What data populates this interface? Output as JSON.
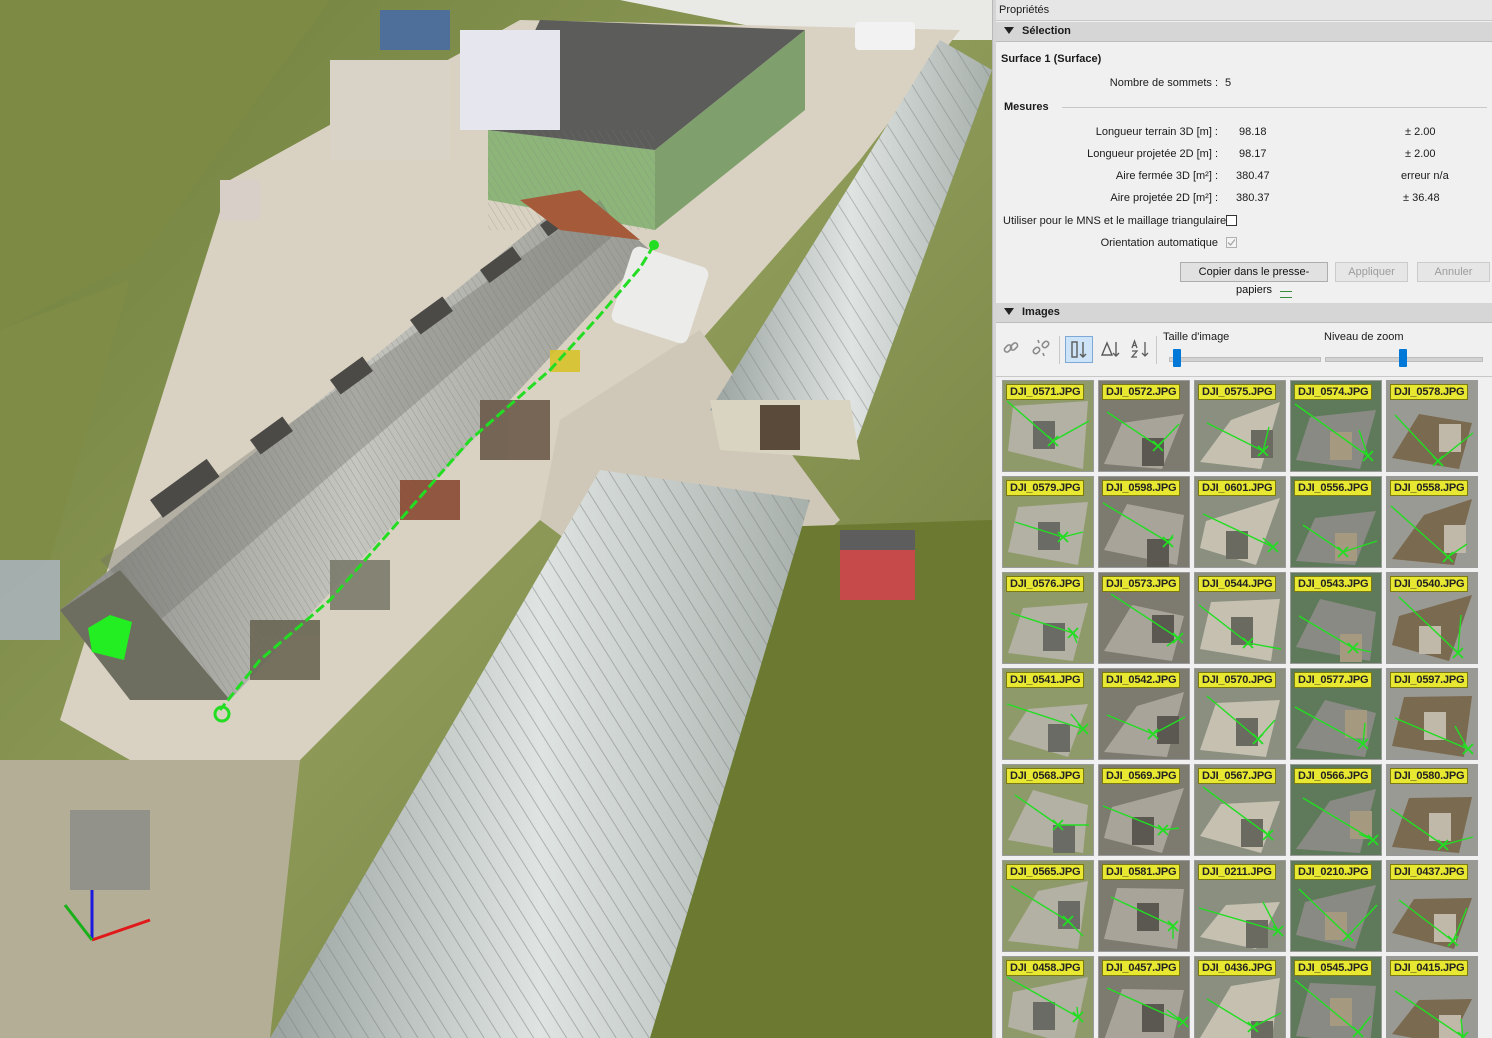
{
  "panel": {
    "title": "Propriétés",
    "selection": {
      "header": "Sélection",
      "object_name": "Surface 1 (Surface)",
      "vertices_label": "Nombre de sommets :",
      "vertices_value": "5",
      "mesures_label": "Mesures",
      "measurements": [
        {
          "label": "Longueur terrain 3D [m] :",
          "value": "98.18",
          "error": "± 2.00"
        },
        {
          "label": "Longueur projetée 2D [m] :",
          "value": "98.17",
          "error": "± 2.00"
        },
        {
          "label": "Aire fermée 3D [m²] :",
          "value": "380.47",
          "error": "erreur n/a"
        },
        {
          "label": "Aire projetée 2D [m²] :",
          "value": "380.37",
          "error": "± 36.48"
        }
      ],
      "use_mns_label": "Utiliser pour le MNS et le maillage triangulaire",
      "use_mns_checked": false,
      "auto_orientation_label": "Orientation automatique",
      "auto_orientation_checked": true,
      "buttons": {
        "copy": "Copier dans le presse-papiers",
        "apply": "Appliquer",
        "cancel": "Annuler"
      }
    },
    "images": {
      "header": "Images",
      "image_size_label": "Taille d'image",
      "image_size_level": 0.05,
      "zoom_label": "Niveau de zoom",
      "zoom_level": 0.5,
      "toolbar_icons": [
        "link-icon",
        "unlink-icon",
        "sort-order-icon",
        "sort-triangle-icon",
        "sort-az-icon"
      ],
      "thumbnails": [
        "DJI_0571.JPG",
        "DJI_0572.JPG",
        "DJI_0575.JPG",
        "DJI_0574.JPG",
        "DJI_0578.JPG",
        "DJI_0579.JPG",
        "DJI_0598.JPG",
        "DJI_0601.JPG",
        "DJI_0556.JPG",
        "DJI_0558.JPG",
        "DJI_0576.JPG",
        "DJI_0573.JPG",
        "DJI_0544.JPG",
        "DJI_0543.JPG",
        "DJI_0540.JPG",
        "DJI_0541.JPG",
        "DJI_0542.JPG",
        "DJI_0570.JPG",
        "DJI_0577.JPG",
        "DJI_0597.JPG",
        "DJI_0568.JPG",
        "DJI_0569.JPG",
        "DJI_0567.JPG",
        "DJI_0566.JPG",
        "DJI_0580.JPG",
        "DJI_0565.JPG",
        "DJI_0581.JPG",
        "DJI_0211.JPG",
        "DJI_0210.JPG",
        "DJI_0437.JPG",
        "DJI_0458.JPG",
        "DJI_0457.JPG",
        "DJI_0436.JPG",
        "DJI_0545.JPG",
        "DJI_0415.JPG"
      ]
    }
  },
  "colors": {
    "accent": "#0078d7",
    "label_bg": "#e8e832",
    "measure_line": "#22dd22"
  }
}
